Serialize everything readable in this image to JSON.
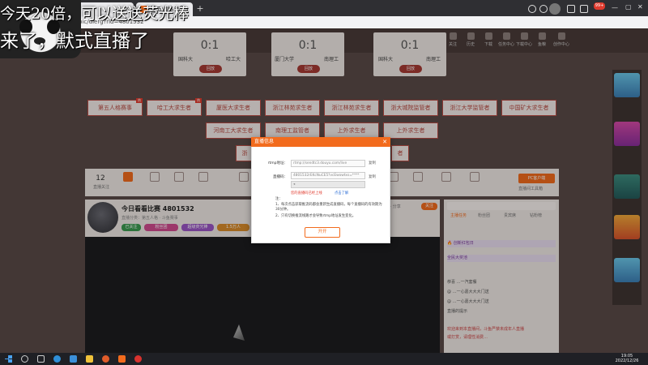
{
  "overlay": {
    "line1": "今天20倍，可以送送荧光棒",
    "line2": "来了，默式直播了"
  },
  "browser": {
    "tab1_label": "",
    "tab2_label": "第五人格斗鱼",
    "url": "topic/dierg?rid=4801532"
  },
  "site": {
    "search_placeholder": "",
    "nav_labels": [
      "关注",
      "历史",
      "下载",
      "任务中心",
      "下载中心",
      "鱼粮",
      "创作中心"
    ]
  },
  "match_cards": [
    {
      "team_a": "国科大",
      "team_b": "哈工大",
      "button": "回放"
    },
    {
      "team_a": "厦门大学",
      "team_b": "南理工",
      "button": "回放"
    },
    {
      "team_a": "国科大",
      "team_b": "南理工",
      "button": "回放"
    }
  ],
  "tags_row1": [
    "第五人格赛事",
    "哈工大求生者",
    "厦医大求生者",
    "浙江林苑求生者",
    "浙江林苑求生者",
    "浙大城院监管者",
    "浙江大学监管者",
    "中国矿大求生者"
  ],
  "tags_row2": [
    "河南工大求生者",
    "南理工监管者",
    "上外求生者",
    "上外求生者"
  ],
  "tags_row3": [
    "浙",
    "者"
  ],
  "toolbar": {
    "count": "12",
    "count_sub": "直播关注",
    "pc_button": "PC客户端",
    "sub_label": "直播间工具箱"
  },
  "room": {
    "title": "今日看看比赛 4801532",
    "subtitle": "直播分类：第五人格 · 斗鱼赛事",
    "badges": [
      "已关注",
      "粉丝团",
      "超级荧光棒",
      "1.5万人"
    ],
    "right_text": "举报 · 分享",
    "follow": "关注"
  },
  "chat": {
    "tabs": [
      "主播任务",
      "粉丝团",
      "贵宾席",
      "钻粉榜"
    ],
    "lines": [
      "🔥 创新红包日",
      "全民大奖池",
      "恭喜 …一汽套餐",
      "@ …一心嘉大大大门送",
      "@ …一心嘉大大大门送",
      "直播的提示",
      "欢迎来到本直播间，斗鱼严禁未成年人直播",
      "或打赏，请理性消费…"
    ]
  },
  "dialog": {
    "title": "直播信息",
    "rtmp_label": "rtmp地址：",
    "rtmp_value": "rtmp://sendtc3.douyu.com/live",
    "code_label": "直播码：",
    "code_value": "4801532rEKcNuCE5?vcEwowtxs=****",
    "copy": "复制",
    "dropdown": "◂",
    "warn": "您的直播码已经上线",
    "warn_link": "点击了解",
    "note_title": "注：",
    "notes": [
      "1、每次点击获取推流码都会重新生成直播码，每个直播码的有效期为30分钟。",
      "2、只有切换推流线路才会导致rtmp地址发生变化。"
    ],
    "open_button": "开开"
  },
  "taskbar": {
    "time": "19:05",
    "date": "2022/12/26"
  },
  "colors": {
    "accent": "#f26b1d",
    "tag_border": "#b84d44",
    "page_bg": "#5a4a47"
  }
}
